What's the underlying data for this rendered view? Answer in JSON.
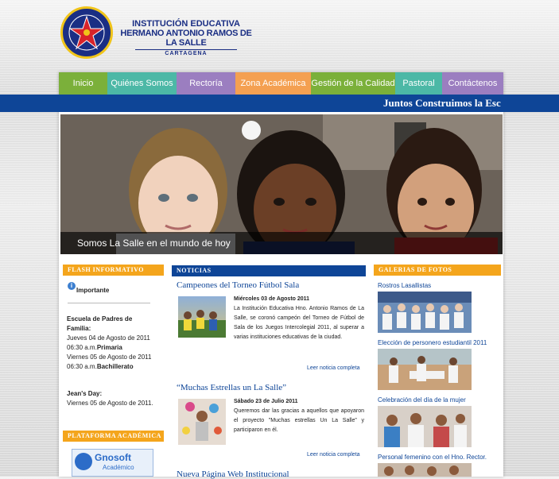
{
  "header": {
    "institution_line1": "INSTITUCIÓN EDUCATIVA",
    "institution_line2": "HERMANO ANTONIO RAMOS DE LA SALLE",
    "institution_city": "CARTAGENA"
  },
  "nav": {
    "tabs": [
      {
        "label": "Inicio",
        "color": "#7bb03a"
      },
      {
        "label": "Quiénes Somos",
        "color": "#4cb8a6"
      },
      {
        "label": "Rectoría",
        "color": "#9b7ec0"
      },
      {
        "label": "Zona Académica",
        "color": "#f4a051"
      },
      {
        "label": "Gestión de la Calidad",
        "color": "#7bb03a"
      },
      {
        "label": "Pastoral",
        "color": "#4cb8a6"
      },
      {
        "label": "Contáctenos",
        "color": "#9b7ec0"
      }
    ]
  },
  "banner": {
    "text": "Juntos Construimos la Esc"
  },
  "hero": {
    "caption": "Somos La Salle en el mundo de hoy"
  },
  "flash": {
    "heading": "FLASH INFORMATIVO",
    "important": "Importante",
    "padres_title1": "Escuela de Padres de",
    "padres_title2": "Familia:",
    "line1": "Jueves 04 de Agosto de 2011",
    "line2": "06:30 a.m.",
    "line2b": "Primaria",
    "line3": "Viernes 05 de Agosto de 2011",
    "line4": "06:30 a.m.",
    "line4b": "Bachillerato",
    "jeans_title": "Jean's Day:",
    "jeans_date": "Viernes 05 de Agosto de 2011."
  },
  "plataforma": {
    "heading": "PLATAFORMA ACADÉMICA",
    "logo_text": "Gnosoft",
    "logo_sub": "Académico"
  },
  "news": {
    "heading": "NOTICIAS",
    "items": [
      {
        "title": "Campeones del Torneo Fútbol Sala",
        "date": "Miércoles 03 de Agosto 2011",
        "body": "La Institución Educativa Hno. Antonio Ramos de La Salle, se coronó campeón del Torneo de Fútbol de Sala de los Juegos Intercolegial 2011, al superar a varias instituciones educativas de la ciudad.",
        "more": "Leer noticia completa"
      },
      {
        "title": "“Muchas Estrellas un La Salle”",
        "date": "Sábado 23 de Julio 2011",
        "body": "Queremos dar las gracias a aquellos que apoyaron el proyecto ”Muchas estrellas Un La Salle” y participaron en él.",
        "more": "Leer noticia completa"
      },
      {
        "title": "Nueva Página Web Institucional"
      }
    ]
  },
  "gallery": {
    "heading": "GALERIAS DE FOTOS",
    "items": [
      "Rostros Lasallistas",
      "Elección de personero estudiantil 2011",
      "Celebración del día de la mujer",
      "Personal femenino con el Hno. Rector."
    ]
  }
}
